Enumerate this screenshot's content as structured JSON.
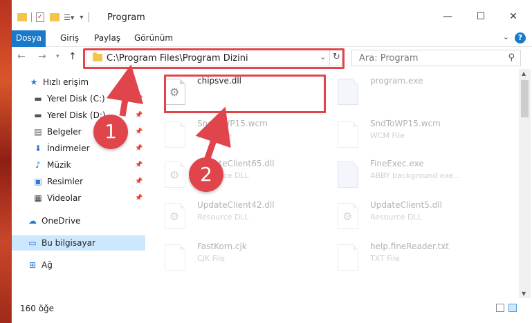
{
  "window": {
    "title": "Program",
    "minimize": "—",
    "maximize": "☐",
    "close": "✕"
  },
  "ribbon": {
    "tabs": [
      "Dosya",
      "Giriş",
      "Paylaş",
      "Görünüm"
    ],
    "help": "?"
  },
  "address": {
    "path": "C:\\Program Files\\Program Dizini"
  },
  "search": {
    "placeholder": "Ara: Program"
  },
  "nav": {
    "quick_access": "Hızlı erişim",
    "items": [
      {
        "label": "Yerel Disk (C:)",
        "pinned": true
      },
      {
        "label": "Yerel Disk (D:)",
        "pinned": true
      },
      {
        "label": "Belgeler",
        "pinned": true
      },
      {
        "label": "İndirmeler",
        "pinned": true
      },
      {
        "label": "Müzik",
        "pinned": true
      },
      {
        "label": "Resimler",
        "pinned": true
      },
      {
        "label": "Videolar",
        "pinned": true
      }
    ],
    "onedrive": "OneDrive",
    "this_pc": "Bu bilgisayar",
    "network": "Ağ"
  },
  "files": [
    {
      "name": "chipsve.dll",
      "type": ""
    },
    {
      "name": "program.exe",
      "type": ""
    },
    {
      "name": "SndToWP15.wcm",
      "type": "WCM File"
    },
    {
      "name": "SndToWP15.wcm",
      "type": "WCM File"
    },
    {
      "name": "UpdateClient65.dll",
      "type": "Resource DLL"
    },
    {
      "name": "FineExec.exe",
      "type": "ABBY background exe..."
    },
    {
      "name": "UpdateClient42.dll",
      "type": "Resource DLL"
    },
    {
      "name": "UpdateClient5.dll",
      "type": "Resource DLL"
    },
    {
      "name": "FastKorn.cjk",
      "type": "CJK File"
    },
    {
      "name": "help.fineReader.txt",
      "type": "TXT File"
    }
  ],
  "status": {
    "count": "160 öğe"
  },
  "annotations": {
    "badge1": "1",
    "badge2": "2"
  },
  "colors": {
    "accent": "#1979ca",
    "highlight": "#e0454b",
    "selected": "#cce8ff"
  }
}
